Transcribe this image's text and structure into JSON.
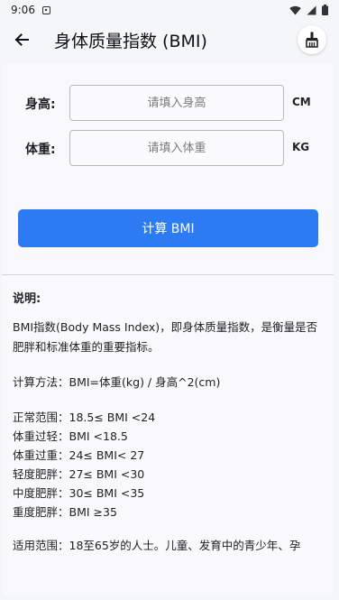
{
  "status_bar": {
    "time": "9:06"
  },
  "app_bar": {
    "title": "身体质量指数 (BMI)",
    "back_icon": "arrow-back-icon",
    "action_icon": "broom-clean-icon"
  },
  "form": {
    "height": {
      "label": "身高:",
      "placeholder": "请填入身高",
      "value": "",
      "unit": "CM"
    },
    "weight": {
      "label": "体重:",
      "placeholder": "请填入体重",
      "value": "",
      "unit": "KG"
    },
    "calculate_label": "计算 BMI"
  },
  "description": {
    "title": "说明:",
    "intro": "BMI指数(Body Mass Index)，即身体质量指数，是衡量是否肥胖和标准体重的重要指标。",
    "formula": "计算方法：BMI=体重(kg) / 身高^2(cm)",
    "ranges": [
      "正常范围：18.5≤ BMI <24",
      "体重过轻：BMI <18.5",
      "体重过重：24≤ BMI< 27",
      "轻度肥胖：27≤ BMI <30",
      "中度肥胖：30≤ BMI <35",
      "重度肥胖：BMI ≥35"
    ],
    "applicable": "适用范围：18至65岁的人士。儿童、发育中的青少年、孕"
  },
  "colors": {
    "accent": "#2d7bf2",
    "background": "#f5f6fa",
    "card": "#f9f9fd"
  }
}
